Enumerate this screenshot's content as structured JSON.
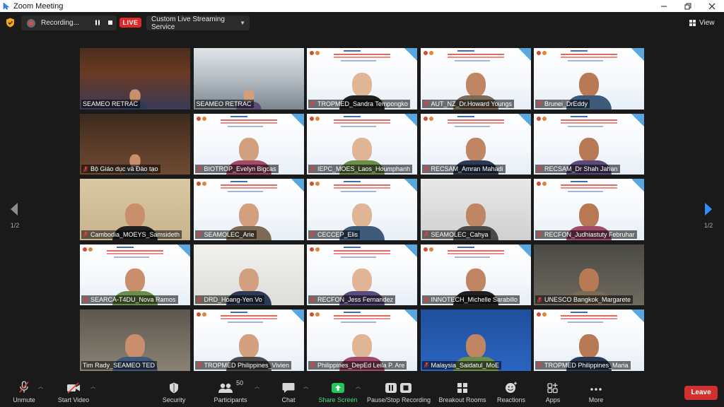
{
  "window": {
    "title": "Zoom Meeting"
  },
  "topbar": {
    "recording_text": "Recording...",
    "live_label": "LIVE",
    "stream_label": "Custom Live Streaming Service",
    "view_label": "View"
  },
  "pagination": {
    "left": "1/2",
    "right": "1/2"
  },
  "participants": [
    {
      "name": "SEAMEO RETRAC",
      "muted": false
    },
    {
      "name": "SEAMEO RETRAC",
      "muted": false,
      "active_speaker": true
    },
    {
      "name": "TROPMED_Sandra Tempongko",
      "muted": true
    },
    {
      "name": "AUT_NZ_Dr.Howard Youngs",
      "muted": true
    },
    {
      "name": "Brunei_DrEddy",
      "muted": true
    },
    {
      "name": "Bộ Giáo dục và Đào tạo",
      "muted": true
    },
    {
      "name": "BIOTROP_Evelyn Bigcas",
      "muted": true
    },
    {
      "name": "IEPC_MOES_Laos_Houmphanh",
      "muted": true
    },
    {
      "name": "RECSAM_Amran Mahadi",
      "muted": true
    },
    {
      "name": "RECSAM_Dr Shah Jahan",
      "muted": true
    },
    {
      "name": "Cambodia_MOEYS_Samsideth",
      "muted": true
    },
    {
      "name": "SEAMOLEC_Arie",
      "muted": true
    },
    {
      "name": "CECCEP_Elis",
      "muted": true
    },
    {
      "name": "SEAMOLEC_Cahya",
      "muted": true
    },
    {
      "name": "RECFON_Judhiastuty Februhar",
      "muted": true
    },
    {
      "name": "SEARCA-T4DU_Nova Ramos",
      "muted": true
    },
    {
      "name": "DRD_Hoang-Yen Vo",
      "muted": true
    },
    {
      "name": "RECFON_Jess Fernandez",
      "muted": true
    },
    {
      "name": "INNOTECH_Michelle Sarabillo",
      "muted": true
    },
    {
      "name": "UNESCO Bangkok_Margarete",
      "muted": true
    },
    {
      "name": "Tim Rady_SEAMEO TED",
      "muted": false
    },
    {
      "name": "TROPMED Philippines_Vivien",
      "muted": true
    },
    {
      "name": "Philippines_DepEd Leila P. Are",
      "muted": true
    },
    {
      "name": "Malaysia_Saidatul_MoE",
      "muted": true
    },
    {
      "name": "TROPMED Philippines_Maria",
      "muted": true
    }
  ],
  "toolbar": {
    "unmute": "Unmute",
    "start_video": "Start Video",
    "security": "Security",
    "participants": "Participants",
    "participants_count": "50",
    "chat": "Chat",
    "share_screen": "Share Screen",
    "pause_recording": "Pause/Stop Recording",
    "breakout_rooms": "Breakout Rooms",
    "reactions": "Reactions",
    "apps": "Apps",
    "more": "More",
    "leave": "Leave"
  },
  "colors": {
    "background": "#1a1a1a",
    "live_red": "#e02828",
    "leave_red": "#d0312f",
    "active_speaker": "#a9d82b",
    "share_green": "#22c55e",
    "arrow_blue": "#2d8cff"
  }
}
